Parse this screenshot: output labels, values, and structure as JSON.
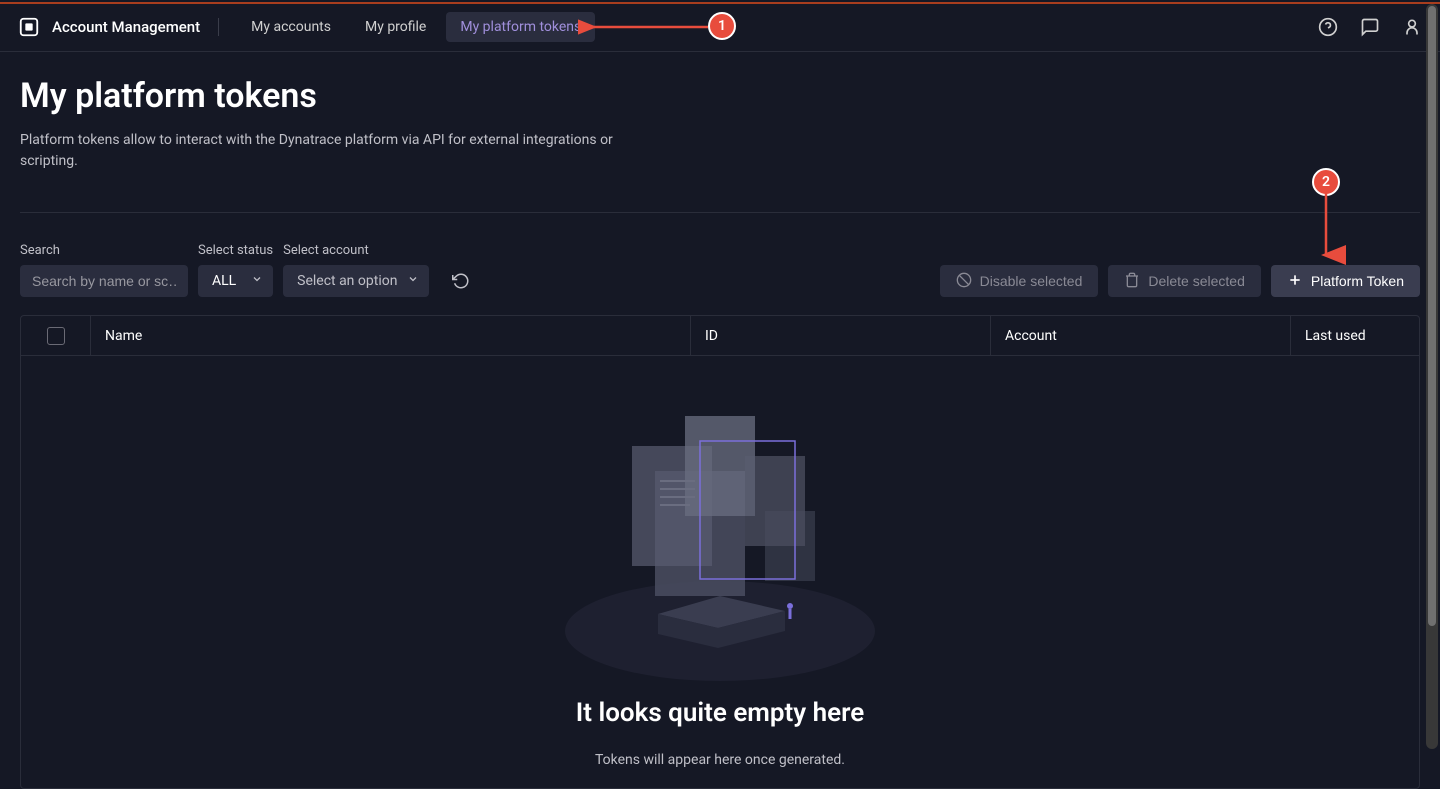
{
  "header": {
    "app_title": "Account Management",
    "nav": [
      {
        "label": "My accounts",
        "active": false
      },
      {
        "label": "My profile",
        "active": false
      },
      {
        "label": "My platform tokens",
        "active": true
      }
    ]
  },
  "page": {
    "title": "My platform tokens",
    "description": "Platform tokens allow to interact with the Dynatrace platform via API for external integrations or scripting."
  },
  "controls": {
    "search_label": "Search",
    "search_placeholder": "Search by name or sc…",
    "status_label": "Select status",
    "status_value": "ALL",
    "account_label": "Select account",
    "account_value": "Select an option",
    "disable_label": "Disable selected",
    "delete_label": "Delete selected",
    "create_label": "Platform Token"
  },
  "table": {
    "columns": {
      "name": "Name",
      "id": "ID",
      "account": "Account",
      "last_used": "Last used"
    }
  },
  "empty_state": {
    "title": "It looks quite empty here",
    "subtitle": "Tokens will appear here once generated."
  },
  "annotations": {
    "a1": "1",
    "a2": "2"
  }
}
